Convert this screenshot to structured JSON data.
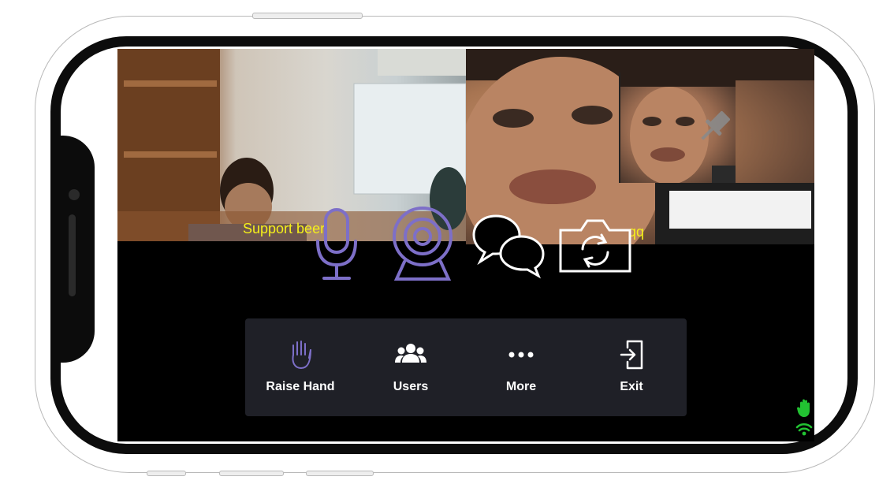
{
  "video_tiles": {
    "left_name": "Support beer",
    "right_name": "qq"
  },
  "media_controls": [
    {
      "name": "microphone",
      "icon": "microphone-icon",
      "color": "#7d6fc8"
    },
    {
      "name": "camera",
      "icon": "webcam-icon",
      "color": "#7d6fc8"
    },
    {
      "name": "chat",
      "icon": "chat-bubbles-icon",
      "color": "#ffffff"
    },
    {
      "name": "switch-camera",
      "icon": "camera-switch-icon",
      "color": "#ffffff"
    }
  ],
  "toolbar": {
    "items": [
      {
        "label": "Raise Hand",
        "icon": "raise-hand-icon"
      },
      {
        "label": "Users",
        "icon": "users-icon"
      },
      {
        "label": "More",
        "icon": "more-dots-icon"
      },
      {
        "label": "Exit",
        "icon": "exit-icon"
      }
    ],
    "background": "#1f2027"
  },
  "status": {
    "hand_color": "#22c232",
    "wifi_color": "#22c232"
  }
}
